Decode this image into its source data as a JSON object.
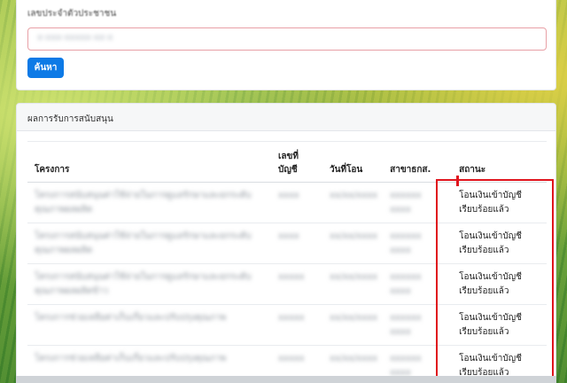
{
  "search": {
    "label": "เลขประจำตัวประชาชน",
    "value": "x-xxx-xxxxx-xx-x",
    "button_label": "ค้นหา"
  },
  "results": {
    "header": "ผลการรับการสนับสนุน",
    "columns": [
      "โครงการ",
      "เลขที่บัญชี",
      "วันที่โอน",
      "สาขาธกส.",
      "สถานะ"
    ],
    "rows": [
      {
        "project": "โครงการสนับสนุนค่าใช้จ่ายในการดูแลรักษาและยกระดับคุณภาพผลผลิต",
        "account": "xxxx",
        "date": "xx/xx/xxxx",
        "branch": "xxxxxx xxxx",
        "status": "โอนเงินเข้าบัญชีเรียบร้อยแล้ว"
      },
      {
        "project": "โครงการสนับสนุนค่าใช้จ่ายในการดูแลรักษาและยกระดับคุณภาพผลผลิต",
        "account": "xxxx",
        "date": "xx/xx/xxxx",
        "branch": "xxxxxx xxxx",
        "status": "โอนเงินเข้าบัญชีเรียบร้อยแล้ว"
      },
      {
        "project": "โครงการสนับสนุนค่าใช้จ่ายในการดูแลรักษาและยกระดับคุณภาพผลผลิตข้าว",
        "account": "xxxxx",
        "date": "xx/xx/xxxx",
        "branch": "xxxxxx xxxx",
        "status": "โอนเงินเข้าบัญชีเรียบร้อยแล้ว"
      },
      {
        "project": "โครงการช่วยเหลือค่าเก็บเกี่ยวและปรับปรุงคุณภาพ",
        "account": "xxxxx",
        "date": "xx/xx/xxxx",
        "branch": "xxxxxx xxxx",
        "status": "โอนเงินเข้าบัญชีเรียบร้อยแล้ว"
      },
      {
        "project": "โครงการช่วยเหลือค่าเก็บเกี่ยวและปรับปรุงคุณภาพ",
        "account": "xxxxx",
        "date": "xx/xx/xxxx",
        "branch": "xxxxxx xxxx",
        "status": "โอนเงินเข้าบัญชีเรียบร้อยแล้ว"
      }
    ]
  },
  "colors": {
    "primary_button": "#0d7ae6",
    "highlight_box": "#e0141d",
    "input_border": "#e8a0a6"
  }
}
